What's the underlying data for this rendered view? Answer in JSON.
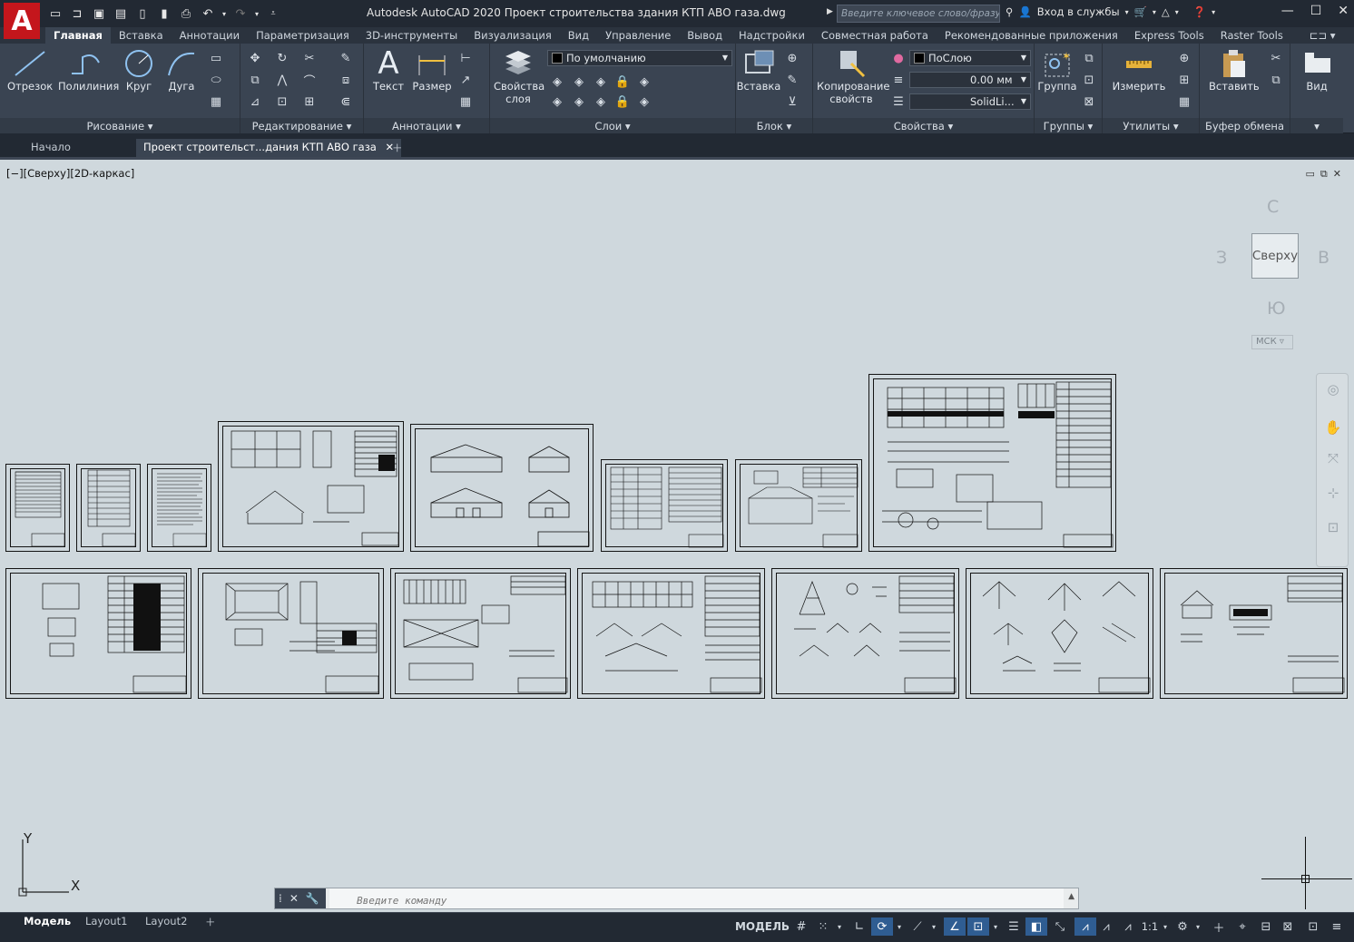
{
  "app": {
    "logo": "A",
    "title": "Autodesk AutoCAD 2020   Проект строительства здания КТП АВО газа.dwg",
    "search_placeholder": "Введите ключевое слово/фразу",
    "signin": "Вход в службы"
  },
  "ribbon_tabs": [
    "Главная",
    "Вставка",
    "Аннотации",
    "Параметризация",
    "3D-инструменты",
    "Визуализация",
    "Вид",
    "Управление",
    "Вывод",
    "Надстройки",
    "Совместная работа",
    "Рекомендованные приложения",
    "Express Tools",
    "Raster Tools"
  ],
  "panels": {
    "draw": {
      "title": "Рисование",
      "line": "Отрезок",
      "polyline": "Полилиния",
      "circle": "Круг",
      "arc": "Дуга"
    },
    "modify": {
      "title": "Редактирование"
    },
    "annotation": {
      "title": "Аннотации",
      "text": "Текст",
      "dimension": "Размер"
    },
    "layers": {
      "title": "Слои",
      "layer_props": "Свойства слоя",
      "current_layer": "По умолчанию"
    },
    "block": {
      "title": "Блок",
      "insert": "Вставка"
    },
    "properties": {
      "title": "Свойства",
      "match": "Копирование свойств",
      "color": "ПоСлою",
      "lineweight": "0.00 мм",
      "linetype": "SolidLi..."
    },
    "groups": {
      "title": "Группы",
      "group": "Группа"
    },
    "utilities": {
      "title": "Утилиты",
      "measure": "Измерить"
    },
    "clipboard": {
      "title": "Буфер обмена",
      "paste": "Вставить"
    },
    "view": {
      "title": "Вид",
      "label": "Вид"
    }
  },
  "doc_tabs": {
    "start": "Начало",
    "drawing": "Проект строительст...дания КТП АВО газа"
  },
  "viewport": {
    "label": "[−][Сверху][2D-каркас]",
    "viewcube": {
      "face": "Сверху",
      "north": "С",
      "south": "Ю",
      "west": "З",
      "east": "В",
      "wcs": "МСК"
    },
    "ucs": {
      "x": "X",
      "y": "Y"
    }
  },
  "command": {
    "placeholder": "Введите команду"
  },
  "layout_tabs": [
    "Модель",
    "Layout1",
    "Layout2"
  ],
  "status": {
    "model": "МОДЕЛЬ",
    "scale": "1:1"
  }
}
